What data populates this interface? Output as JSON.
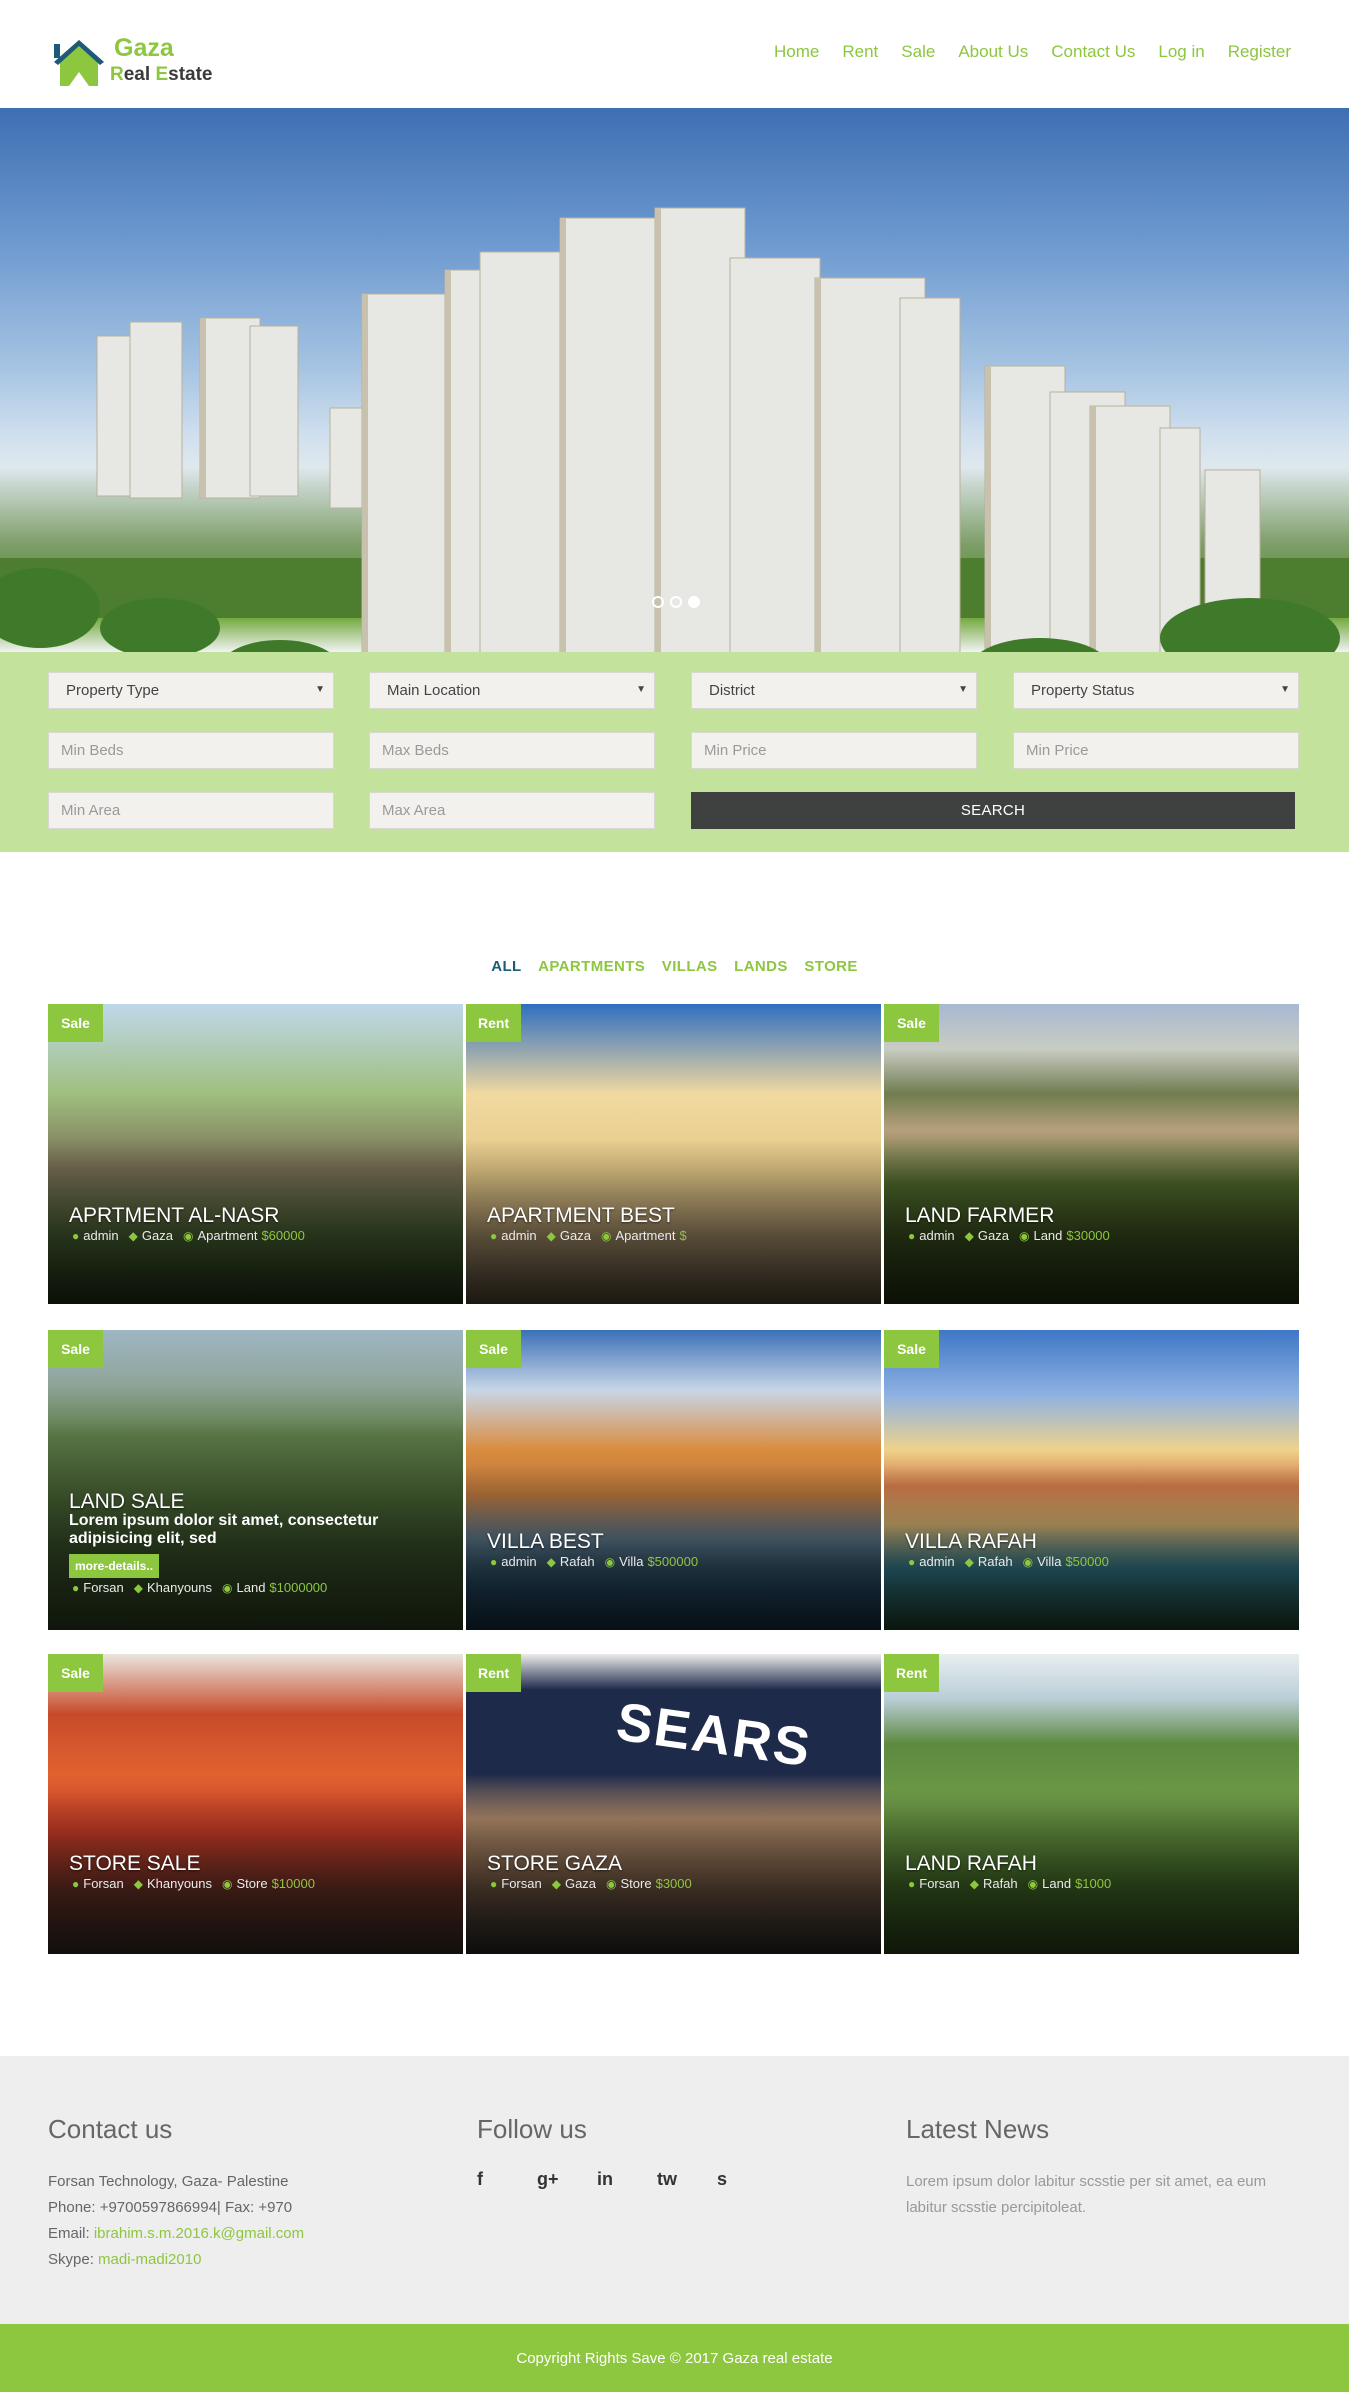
{
  "brand": {
    "word1": "Gaza",
    "word2_first": "R",
    "word2_rest1": "eal ",
    "word2_second": "E",
    "word2_rest2": "state",
    "accent": "#8dc63f"
  },
  "nav": [
    "Home",
    "Rent",
    "Sale",
    "About Us",
    "Contact Us",
    "Log in",
    "Register"
  ],
  "hero": {
    "slides": 3,
    "active_slide": 3
  },
  "search": {
    "selects": [
      "Property Type",
      "Main Location",
      "District",
      "Property Status"
    ],
    "inputs_row2": [
      "Min Beds",
      "Max Beds",
      "Min Price",
      "Min Price"
    ],
    "inputs_row3": [
      "Min Area",
      "Max Area"
    ],
    "button": "SEARCH"
  },
  "filters": [
    "ALL",
    "APARTMENTS",
    "VILLAS",
    "LANDS",
    "STORE"
  ],
  "listings": [
    {
      "badge": "Sale",
      "title": "APRTMENT AL-NASR",
      "user": "admin",
      "location": "Gaza",
      "type": "Apartment",
      "price": "$60000"
    },
    {
      "badge": "Rent",
      "title": "APARTMENT BEST",
      "user": "admin",
      "location": "Gaza",
      "type": "Apartment",
      "price": "$"
    },
    {
      "badge": "Sale",
      "title": "LAND FARMER",
      "user": "admin",
      "location": "Gaza",
      "type": "Land",
      "price": "$30000"
    },
    {
      "badge": "Sale",
      "title": "LAND SALE",
      "desc": "Lorem ipsum dolor sit amet, consectetur adipisicing elit, sed",
      "more": "more-details..",
      "user": "Forsan",
      "location": "Khanyouns",
      "type": "Land",
      "price": "$1000000"
    },
    {
      "badge": "Sale",
      "title": "VILLA BEST",
      "user": "admin",
      "location": "Rafah",
      "type": "Villa",
      "price": "$500000"
    },
    {
      "badge": "Sale",
      "title": "VILLA RAFAH",
      "user": "admin",
      "location": "Rafah",
      "type": "Villa",
      "price": "$50000"
    },
    {
      "badge": "Sale",
      "title": "STORE SALE",
      "user": "Forsan",
      "location": "Khanyouns",
      "type": "Store",
      "price": "$10000"
    },
    {
      "badge": "Rent",
      "title": "STORE GAZA",
      "user": "Forsan",
      "location": "Gaza",
      "type": "Store",
      "price": "$3000"
    },
    {
      "badge": "Rent",
      "title": "LAND RAFAH",
      "user": "Forsan",
      "location": "Rafah",
      "type": "Land",
      "price": "$1000"
    }
  ],
  "store_sign": "SEARS",
  "footer": {
    "contact": {
      "title": "Contact us",
      "address": "Forsan Technology, Gaza- Palestine",
      "phone": "Phone: +9700597866994| Fax: +970",
      "email_label": "Email: ",
      "email": "ibrahim.s.m.2016.k@gmail.com",
      "skype_label": "Skype: ",
      "skype": "madi-madi2010"
    },
    "follow": {
      "title": "Follow us",
      "icons": [
        "f",
        "g+",
        "in",
        "tw",
        "s"
      ]
    },
    "news": {
      "title": "Latest News",
      "text": "Lorem ipsum dolor labitur scsstie per sit amet, ea eum labitur scsstie percipitoleat."
    },
    "copyright": "Copyright Rights Save © 2017 Gaza real estate"
  }
}
